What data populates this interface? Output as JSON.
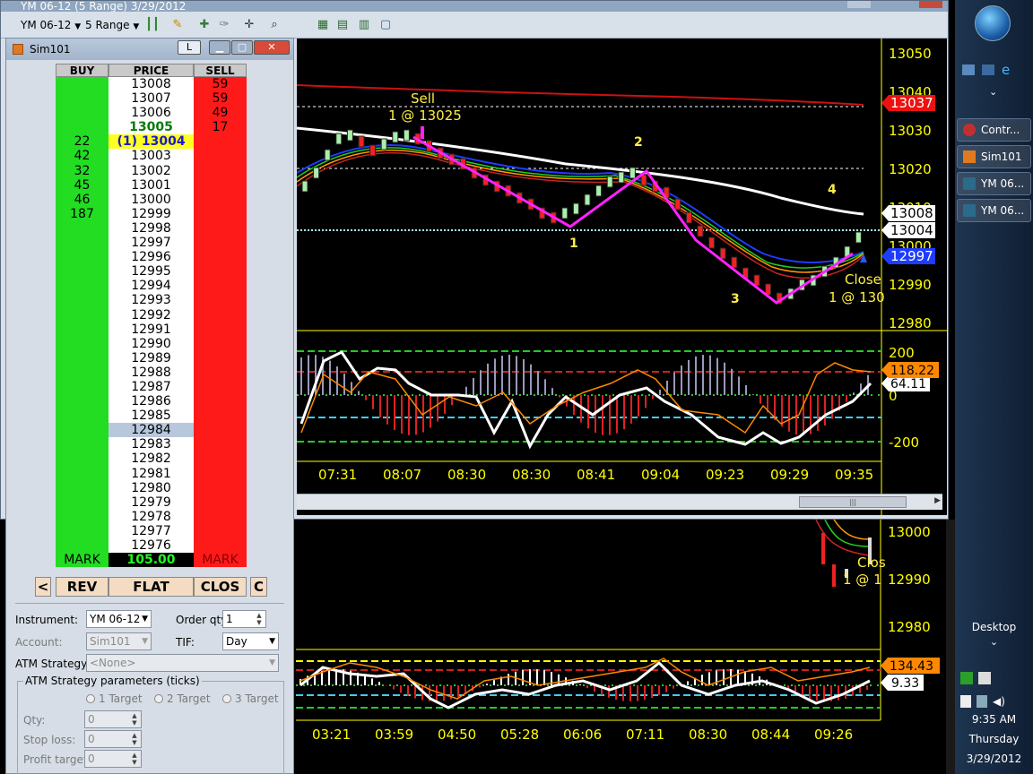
{
  "window": {
    "title": "YM 06-12 (5 Range)  3/29/2012",
    "instrument_label": "YM 06-12",
    "period_label": "5 Range"
  },
  "panel": {
    "title": "Sim101",
    "l_button": "L",
    "headers": {
      "buy": "BUY",
      "price": "PRICE",
      "sell": "SELL"
    },
    "rows": [
      {
        "buy": "",
        "price": "13008",
        "sell": "59"
      },
      {
        "buy": "",
        "price": "13007",
        "sell": "59"
      },
      {
        "buy": "",
        "price": "13006",
        "sell": "49"
      },
      {
        "buy": "",
        "price": "13005",
        "sell": "17"
      },
      {
        "buy": "22",
        "price": "(1) 13004",
        "sell": ""
      },
      {
        "buy": "42",
        "price": "13003",
        "sell": ""
      },
      {
        "buy": "32",
        "price": "13002",
        "sell": ""
      },
      {
        "buy": "45",
        "price": "13001",
        "sell": ""
      },
      {
        "buy": "46",
        "price": "13000",
        "sell": ""
      },
      {
        "buy": "187",
        "price": "12999",
        "sell": ""
      },
      {
        "buy": "",
        "price": "12998",
        "sell": ""
      },
      {
        "buy": "",
        "price": "12997",
        "sell": ""
      },
      {
        "buy": "",
        "price": "12996",
        "sell": ""
      },
      {
        "buy": "",
        "price": "12995",
        "sell": ""
      },
      {
        "buy": "",
        "price": "12994",
        "sell": ""
      },
      {
        "buy": "",
        "price": "12993",
        "sell": ""
      },
      {
        "buy": "",
        "price": "12992",
        "sell": ""
      },
      {
        "buy": "",
        "price": "12991",
        "sell": ""
      },
      {
        "buy": "",
        "price": "12990",
        "sell": ""
      },
      {
        "buy": "",
        "price": "12989",
        "sell": ""
      },
      {
        "buy": "",
        "price": "12988",
        "sell": ""
      },
      {
        "buy": "",
        "price": "12987",
        "sell": ""
      },
      {
        "buy": "",
        "price": "12986",
        "sell": ""
      },
      {
        "buy": "",
        "price": "12985",
        "sell": ""
      },
      {
        "buy": "",
        "price": "12984",
        "sell": ""
      },
      {
        "buy": "",
        "price": "12983",
        "sell": ""
      },
      {
        "buy": "",
        "price": "12982",
        "sell": ""
      },
      {
        "buy": "",
        "price": "12981",
        "sell": ""
      },
      {
        "buy": "",
        "price": "12980",
        "sell": ""
      },
      {
        "buy": "",
        "price": "12979",
        "sell": ""
      },
      {
        "buy": "",
        "price": "12978",
        "sell": ""
      },
      {
        "buy": "",
        "price": "12977",
        "sell": ""
      },
      {
        "buy": "",
        "price": "12976",
        "sell": ""
      }
    ],
    "mark_left": "MARK",
    "mark_value": "105.00",
    "mark_right": "MARK",
    "buttons": {
      "left": "<",
      "rev": "REV",
      "flat": "FLAT",
      "close": "CLOS",
      "c": "C"
    },
    "form": {
      "instrument_label": "Instrument:",
      "instrument_value": "YM 06-12",
      "order_qty_label": "Order qty:",
      "order_qty_value": "1",
      "account_label": "Account:",
      "account_value": "Sim101",
      "tif_label": "TIF:",
      "tif_value": "Day",
      "atm_label": "ATM Strategy:",
      "atm_value": "<None>",
      "atm_params_label": "ATM Strategy parameters (ticks)",
      "target1": "1 Target",
      "target2": "2 Target",
      "target3": "3 Target",
      "qty_label": "Qty:",
      "qty_value": "0",
      "stop_label": "Stop loss:",
      "stop_value": "0",
      "profit_label": "Profit target:",
      "profit_value": "0"
    }
  },
  "chart": {
    "price_axis": [
      "13050",
      "13040",
      "13030",
      "13020",
      "13010",
      "13000",
      "12990",
      "12980"
    ],
    "price_tags": {
      "red": "13037",
      "white1": "13008",
      "white2": "13004",
      "blue": "12997"
    },
    "annotations": {
      "sell": "Sell",
      "sell_detail": "1 @ 13025",
      "close": "Close",
      "close_detail": "1 @ 130",
      "wave1": "1",
      "wave2": "2",
      "wave3": "3",
      "wave4": "4"
    },
    "osc_axis": [
      "200",
      "0",
      "-200"
    ],
    "osc_tags": {
      "orange": "118.22",
      "white": "64.11"
    },
    "time_axis": [
      "07:31",
      "08:07",
      "08:30",
      "08:30",
      "08:41",
      "09:04",
      "09:23",
      "09:29",
      "09:35"
    ]
  },
  "lower_chart": {
    "price_axis": [
      "13000",
      "12990",
      "12980"
    ],
    "annotations": {
      "close": "Clos",
      "close_detail": "1 @ 1"
    },
    "osc_tags": {
      "orange": "134.43",
      "white": "9.33"
    },
    "time_axis": [
      "03:21",
      "03:59",
      "04:50",
      "05:28",
      "06:06",
      "07:11",
      "08:30",
      "08:44",
      "09:26"
    ]
  },
  "taskbar": {
    "items": [
      "Contr...",
      "Sim101",
      "YM 06...",
      "YM 06..."
    ],
    "desktop": "Desktop",
    "time": "9:35 AM",
    "day": "Thursday",
    "date": "3/29/2012"
  },
  "colors": {
    "buy_green": "#22dd22",
    "sell_red": "#ff1a1a",
    "axis_yellow": "#ffff00",
    "zigzag_magenta": "#ff22ff"
  }
}
